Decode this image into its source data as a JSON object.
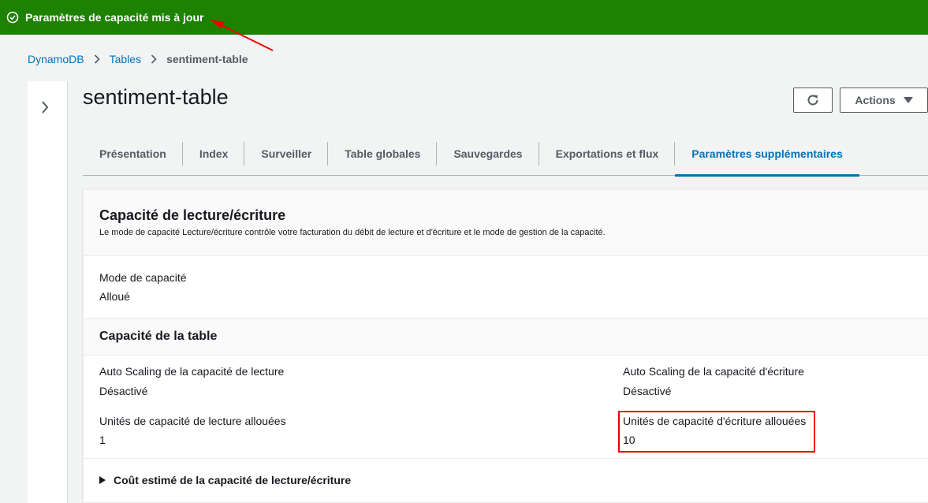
{
  "flash": {
    "message": "Paramètres de capacité mis à jour",
    "icon": "check-circle-icon",
    "color": "#1d8102"
  },
  "breadcrumb": {
    "items": [
      "DynamoDB",
      "Tables"
    ],
    "current": "sentiment-table"
  },
  "page": {
    "title": "sentiment-table"
  },
  "toolbar": {
    "refresh_icon": "refresh-icon",
    "actions_label": "Actions"
  },
  "tabs": [
    {
      "label": "Présentation",
      "active": false
    },
    {
      "label": "Index",
      "active": false
    },
    {
      "label": "Surveiller",
      "active": false
    },
    {
      "label": "Table globales",
      "active": false
    },
    {
      "label": "Sauvegardes",
      "active": false
    },
    {
      "label": "Exportations et flux",
      "active": false
    },
    {
      "label": "Paramètres supplémentaires",
      "active": true
    }
  ],
  "capacity": {
    "title": "Capacité de lecture/écriture",
    "description": "Le mode de capacité Lecture/écriture contrôle votre facturation du débit de lecture et d'écriture et le mode de gestion de la capacité.",
    "mode_label": "Mode de capacité",
    "mode_value": "Alloué",
    "table_capacity_title": "Capacité de la table",
    "read_autoscaling_label": "Auto Scaling de la capacité de lecture",
    "read_autoscaling_value": "Désactivé",
    "write_autoscaling_label": "Auto Scaling de la capacité d'écriture",
    "write_autoscaling_value": "Désactivé",
    "read_units_label": "Unités de capacité de lecture allouées",
    "read_units_value": "1",
    "write_units_label": "Unités de capacité d'écriture allouées",
    "write_units_value": "10",
    "estimated_cost_label": "Coût estimé de la capacité de lecture/écriture"
  },
  "colors": {
    "link": "#0073bb",
    "highlight": "#e00000",
    "arrow": "#e00000"
  }
}
